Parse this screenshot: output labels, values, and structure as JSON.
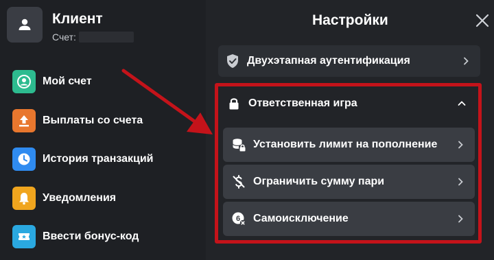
{
  "user": {
    "name": "Клиент",
    "account_label": "Счет:"
  },
  "menu": [
    {
      "label": "Мой счет",
      "icon": "user-circle-icon",
      "color": "#2dbb8f"
    },
    {
      "label": "Выплаты со счета",
      "icon": "upload-icon",
      "color": "#e8772e"
    },
    {
      "label": "История транзакций",
      "icon": "clock-icon",
      "color": "#2f8bf0"
    },
    {
      "label": "Уведомления",
      "icon": "bell-icon",
      "color": "#f0a51e"
    },
    {
      "label": "Ввести бонус-код",
      "icon": "ticket-icon",
      "color": "#2aa8e0"
    }
  ],
  "settings": {
    "title": "Настройки",
    "two_factor": "Двухэтапная аутентификация",
    "responsible_gaming": {
      "title": "Ответственная игра",
      "items": [
        {
          "label": "Установить лимит на пополнение",
          "icon": "coins-lock-icon"
        },
        {
          "label": "Ограничить сумму пари",
          "icon": "dollar-crossed-icon"
        },
        {
          "label": "Самоисключение",
          "icon": "self-exclusion-icon"
        }
      ]
    }
  },
  "colors": {
    "highlight": "#c4131a",
    "arrow": "#c4131a"
  }
}
